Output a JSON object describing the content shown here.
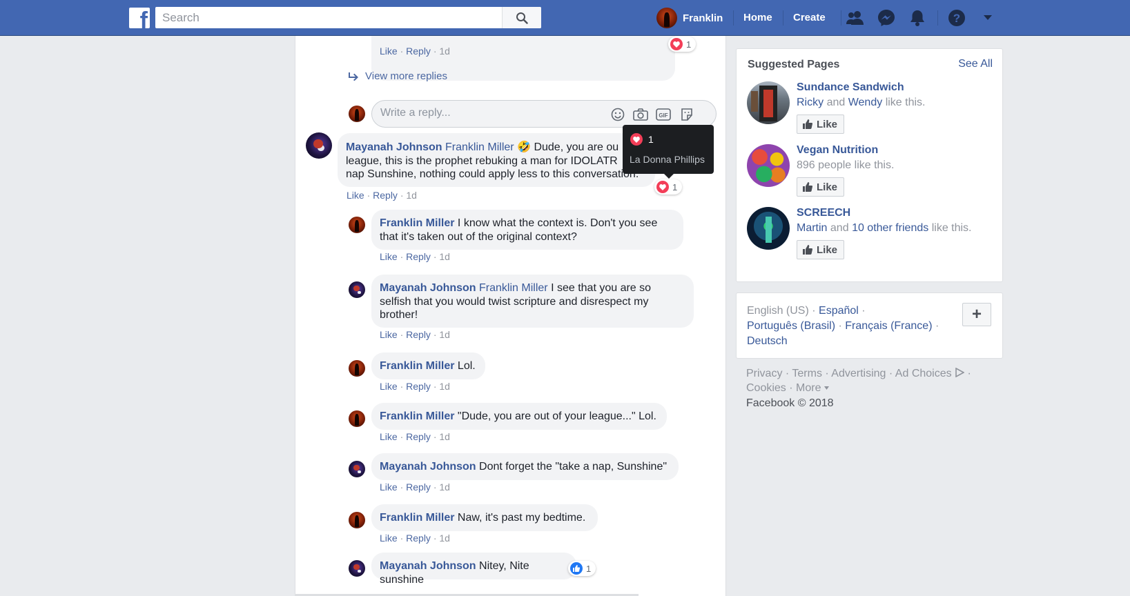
{
  "topbar": {
    "logo_letter": "f",
    "search_placeholder": "Search",
    "user_name": "Franklin",
    "home_label": "Home",
    "create_label": "Create"
  },
  "thread": {
    "prev_actions": {
      "like": "Like",
      "reply": "Reply",
      "time": "1d"
    },
    "prev_reaction_count": "1",
    "view_more_label": "View more replies",
    "reply_placeholder": "Write a reply...",
    "gif_label": "GIF",
    "main_comment": {
      "author": "Mayanah Johnson",
      "mention": "Franklin Miller",
      "emoji": "🤣",
      "line1": "Dude, you are ou",
      "line2": "league, this is the prophet rebuking a man for IDOLATR",
      "line3": "nap Sunshine, nothing could apply less to this conversation.",
      "reaction_count": "1",
      "actions": {
        "like": "Like",
        "reply": "Reply",
        "time": "1d"
      }
    },
    "tooltip": {
      "count": "1",
      "name": "La Donna Phillips"
    },
    "replies": [
      {
        "author": "Franklin Miller",
        "mention": "",
        "text": "I know what the context is. Don't you see",
        "text2": "that it's taken out of the original context?",
        "text3": "",
        "time": "1d"
      },
      {
        "author": "Mayanah Johnson",
        "mention": "Franklin Miller",
        "text": "I see that you are so",
        "text2": "selfish that you would twist scripture and disrespect my",
        "text3": "brother!",
        "time": "1d"
      },
      {
        "author": "Franklin Miller",
        "mention": "",
        "text": "Lol.",
        "text2": "",
        "text3": "",
        "time": "1d"
      },
      {
        "author": "Franklin Miller",
        "mention": "",
        "text": "\"Dude, you are out of your league...\" Lol.",
        "text2": "",
        "text3": "",
        "time": "1d"
      },
      {
        "author": "Mayanah Johnson",
        "mention": "",
        "text": "Dont forget the \"take a nap, Sunshine\"",
        "text2": "",
        "text3": "",
        "time": "1d"
      },
      {
        "author": "Franklin Miller",
        "mention": "",
        "text": "Naw, it's past my bedtime.",
        "text2": "",
        "text3": "",
        "time": "1d"
      },
      {
        "author": "Mayanah Johnson",
        "mention": "",
        "text": "Nitey, Nite sunshine",
        "text2": "",
        "text3": "",
        "time": "",
        "reaction_count": "1"
      }
    ],
    "like_label": "Like",
    "reply_label": "Reply"
  },
  "suggested": {
    "title": "Suggested Pages",
    "see_all": "See All",
    "like_label": "Like",
    "pages": [
      {
        "name": "Sundance Sandwich",
        "friend1": "Ricky",
        "and": "and",
        "friend2": "Wendy",
        "suffix": "like this."
      },
      {
        "name": "Vegan Nutrition",
        "meta": "896 people like this."
      },
      {
        "name": "SCREECH",
        "friend1": "Martin",
        "and": "and",
        "friend2": "10 other friends",
        "suffix": "like this."
      }
    ]
  },
  "languages": {
    "current": "English (US)",
    "es": "Español",
    "pt": "Português (Brasil)",
    "fr": "Français (France)",
    "de": "Deutsch",
    "add": "+"
  },
  "footer": {
    "privacy": "Privacy",
    "terms": "Terms",
    "advertising": "Advertising",
    "ad_choices": "Ad Choices",
    "cookies": "Cookies",
    "more": "More",
    "copyright": "Facebook © 2018"
  },
  "colors": {
    "brand": "#4267b2",
    "link": "#385898",
    "heart": "#f33e58",
    "like_blue": "#2078f4"
  }
}
